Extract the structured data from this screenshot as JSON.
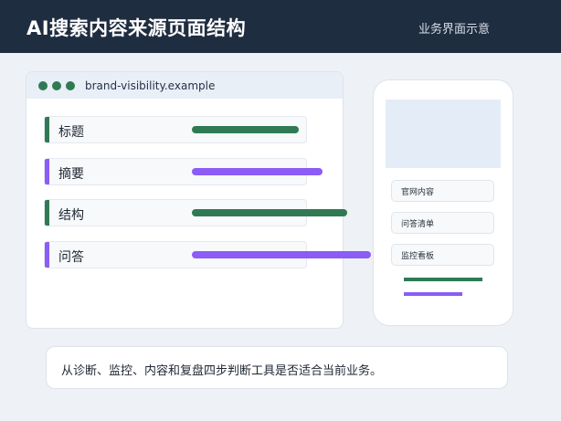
{
  "header": {
    "title": "AI搜索内容来源页面结构",
    "subtitle": "业务界面示意"
  },
  "browser": {
    "url": "brand-visibility.example",
    "rows": [
      {
        "label": "标题",
        "color": "#2f7a55"
      },
      {
        "label": "摘要",
        "color": "#8b5cf6"
      },
      {
        "label": "结构",
        "color": "#2f7a55"
      },
      {
        "label": "问答",
        "color": "#8b5cf6"
      }
    ]
  },
  "phone": {
    "items": [
      "官网内容",
      "问答清单",
      "监控看板"
    ]
  },
  "note": {
    "text": "从诊断、监控、内容和复盘四步判断工具是否适合当前业务。"
  },
  "colors": {
    "header_bg": "#1f2d40",
    "green": "#2f7a55",
    "purple": "#8b5cf6"
  }
}
